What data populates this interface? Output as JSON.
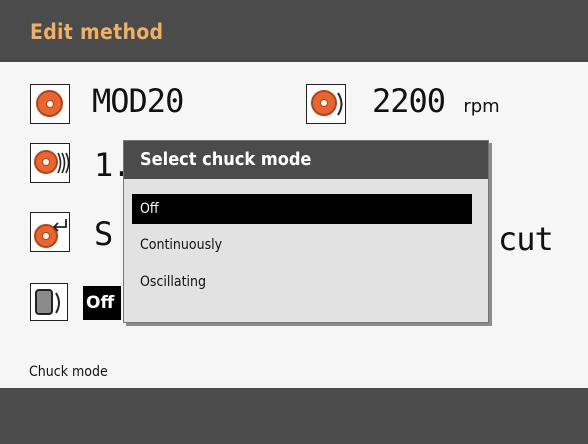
{
  "title": "Edit method",
  "rows": {
    "method_name": "MOD20",
    "speed_value": "2200",
    "speed_unit": "rpm",
    "row2_value": "1.",
    "row3_value_left": "S",
    "row3_value_right": "cut",
    "chuck_mode_value": "Off"
  },
  "dialog": {
    "title": "Select chuck mode",
    "options": [
      "Off",
      "Continuously",
      "Oscillating"
    ],
    "selected_index": 0
  },
  "status": {
    "label": "Chuck mode"
  },
  "colors": {
    "title_bar": "#4b4b4b",
    "title_text": "#f0b060",
    "disc_orange": "#e9642e",
    "selection_bg": "#000000"
  },
  "icons": {
    "row1_left": "disc-icon",
    "row1_right": "disc-speed-icon",
    "row2": "disc-waves-icon",
    "row3": "disc-return-icon",
    "row4": "chuck-icon"
  }
}
